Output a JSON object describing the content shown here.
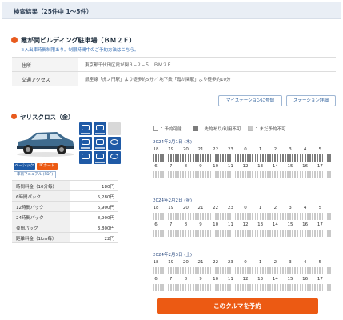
{
  "header": {
    "title": "検索結果（25件中 1〜5件）"
  },
  "lot": {
    "name": "霞が関ビルディング駐車場（ＢＭ２Ｆ）",
    "note": "※入出庫時間制限あり。制限時間中のご予約方法はこちら。",
    "rows": [
      {
        "label": "住所",
        "value": "東京都千代田区霞が関３−２−５　ＢＭ２Ｆ"
      },
      {
        "label": "交通アクセス",
        "value": "銀座線「虎ノ門駅」より徒歩約5分／ 地下鉄「霞が関駅」より徒歩約10分"
      }
    ]
  },
  "buttons": {
    "mystation": "マイステーションに登録",
    "detail": "ステーション詳細"
  },
  "car": {
    "name": "ヤリスクロス（金）",
    "features": [
      {
        "icon": "navi-icon",
        "on": true
      },
      {
        "icon": "etc-icon",
        "on": true
      },
      {
        "icon": "no-smoking-icon",
        "on": false
      },
      {
        "icon": "back-monitor-icon",
        "on": true
      },
      {
        "icon": "drive-recorder-icon",
        "on": true
      },
      {
        "icon": "snow-tire-icon",
        "on": true
      },
      {
        "icon": "bluetooth-icon",
        "on": true
      },
      {
        "icon": "brake-assist-icon",
        "on": true
      },
      {
        "icon": "usb-icon",
        "on": true
      }
    ],
    "tags": {
      "basic": "ベーシック",
      "ic": "ICカード",
      "manual": "車両マニュアル (PDF)"
    },
    "prices": [
      {
        "label": "時間料金（10分毎）",
        "value": "180円"
      },
      {
        "label": "6時間パック",
        "value": "5,280円"
      },
      {
        "label": "12時間パック",
        "value": "6,900円"
      },
      {
        "label": "24時間パック",
        "value": "8,900円"
      },
      {
        "label": "夜間パック",
        "value": "3,800円"
      },
      {
        "label": "距離料金（1km毎）",
        "value": "22円"
      }
    ]
  },
  "legend": {
    "available": "：予約可能",
    "busy": "：先約あり/利用不可",
    "soon": "：まだ予約不可"
  },
  "schedule": {
    "days": [
      {
        "date": "2024年2月1日 (木)"
      },
      {
        "date": "2024年2月2日 (金)"
      },
      {
        "date": "2024年2月3日 (土)"
      }
    ],
    "hours_top": [
      "18",
      "19",
      "20",
      "21",
      "22",
      "23",
      "0",
      "1",
      "2",
      "3",
      "4",
      "5"
    ],
    "hours_bottom": [
      "6",
      "7",
      "8",
      "9",
      "10",
      "11",
      "12",
      "13",
      "14",
      "15",
      "16",
      "17"
    ]
  },
  "cta": {
    "label": "このクルマを予約"
  },
  "colors": {
    "accent": "#ec5a13",
    "feature": "#1f5aa6",
    "busy": "#7c7c7c",
    "soon": "#c9c9c9"
  }
}
